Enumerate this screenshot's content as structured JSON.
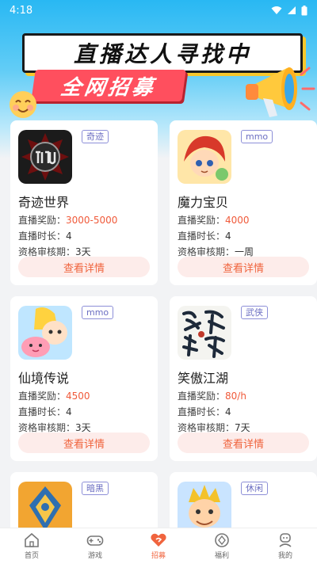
{
  "status": {
    "time": "4:18"
  },
  "banner": {
    "line1": "直播达人寻找中",
    "line2": "全网招募"
  },
  "common": {
    "reward_label": "直播奖励：",
    "duration_label": "直播时长：",
    "review_label": "资格审核期：",
    "detail_button": "查看详情"
  },
  "games": [
    {
      "name": "奇迹世界",
      "tag": "奇迹",
      "reward": "3000-5000",
      "duration": "4",
      "review": "3天",
      "icon": "miu-logo-icon"
    },
    {
      "name": "魔力宝贝",
      "tag": "mmo",
      "reward": "4000",
      "duration": "4",
      "review": "一周",
      "icon": "crossgate-hero-icon"
    },
    {
      "name": "仙境传说",
      "tag": "mmo",
      "reward": "4500",
      "duration": "4",
      "review": "3天",
      "icon": "ragnarok-poring-icon"
    },
    {
      "name": "笑傲江湖",
      "tag": "武侠",
      "reward": "80/h",
      "duration": "4",
      "review": "7天",
      "icon": "xiaoao-calligraphy-icon"
    },
    {
      "name": "",
      "tag": "暗黑",
      "icon": "dark-emblem-icon"
    },
    {
      "name": "",
      "tag": "休闲",
      "icon": "casual-hero-icon"
    }
  ],
  "tabbar": {
    "items": [
      {
        "label": "首页",
        "icon": "home-icon"
      },
      {
        "label": "游戏",
        "icon": "gamepad-icon"
      },
      {
        "label": "招募",
        "icon": "recruit-heart-icon",
        "active": true
      },
      {
        "label": "福利",
        "icon": "gift-icon"
      },
      {
        "label": "我的",
        "icon": "profile-icon"
      }
    ]
  },
  "colors": {
    "accent": "#f0643e",
    "banner_red": "#ff4f5e",
    "tag_purple": "#6b6ec2",
    "sky_blue": "#29b8f3"
  }
}
